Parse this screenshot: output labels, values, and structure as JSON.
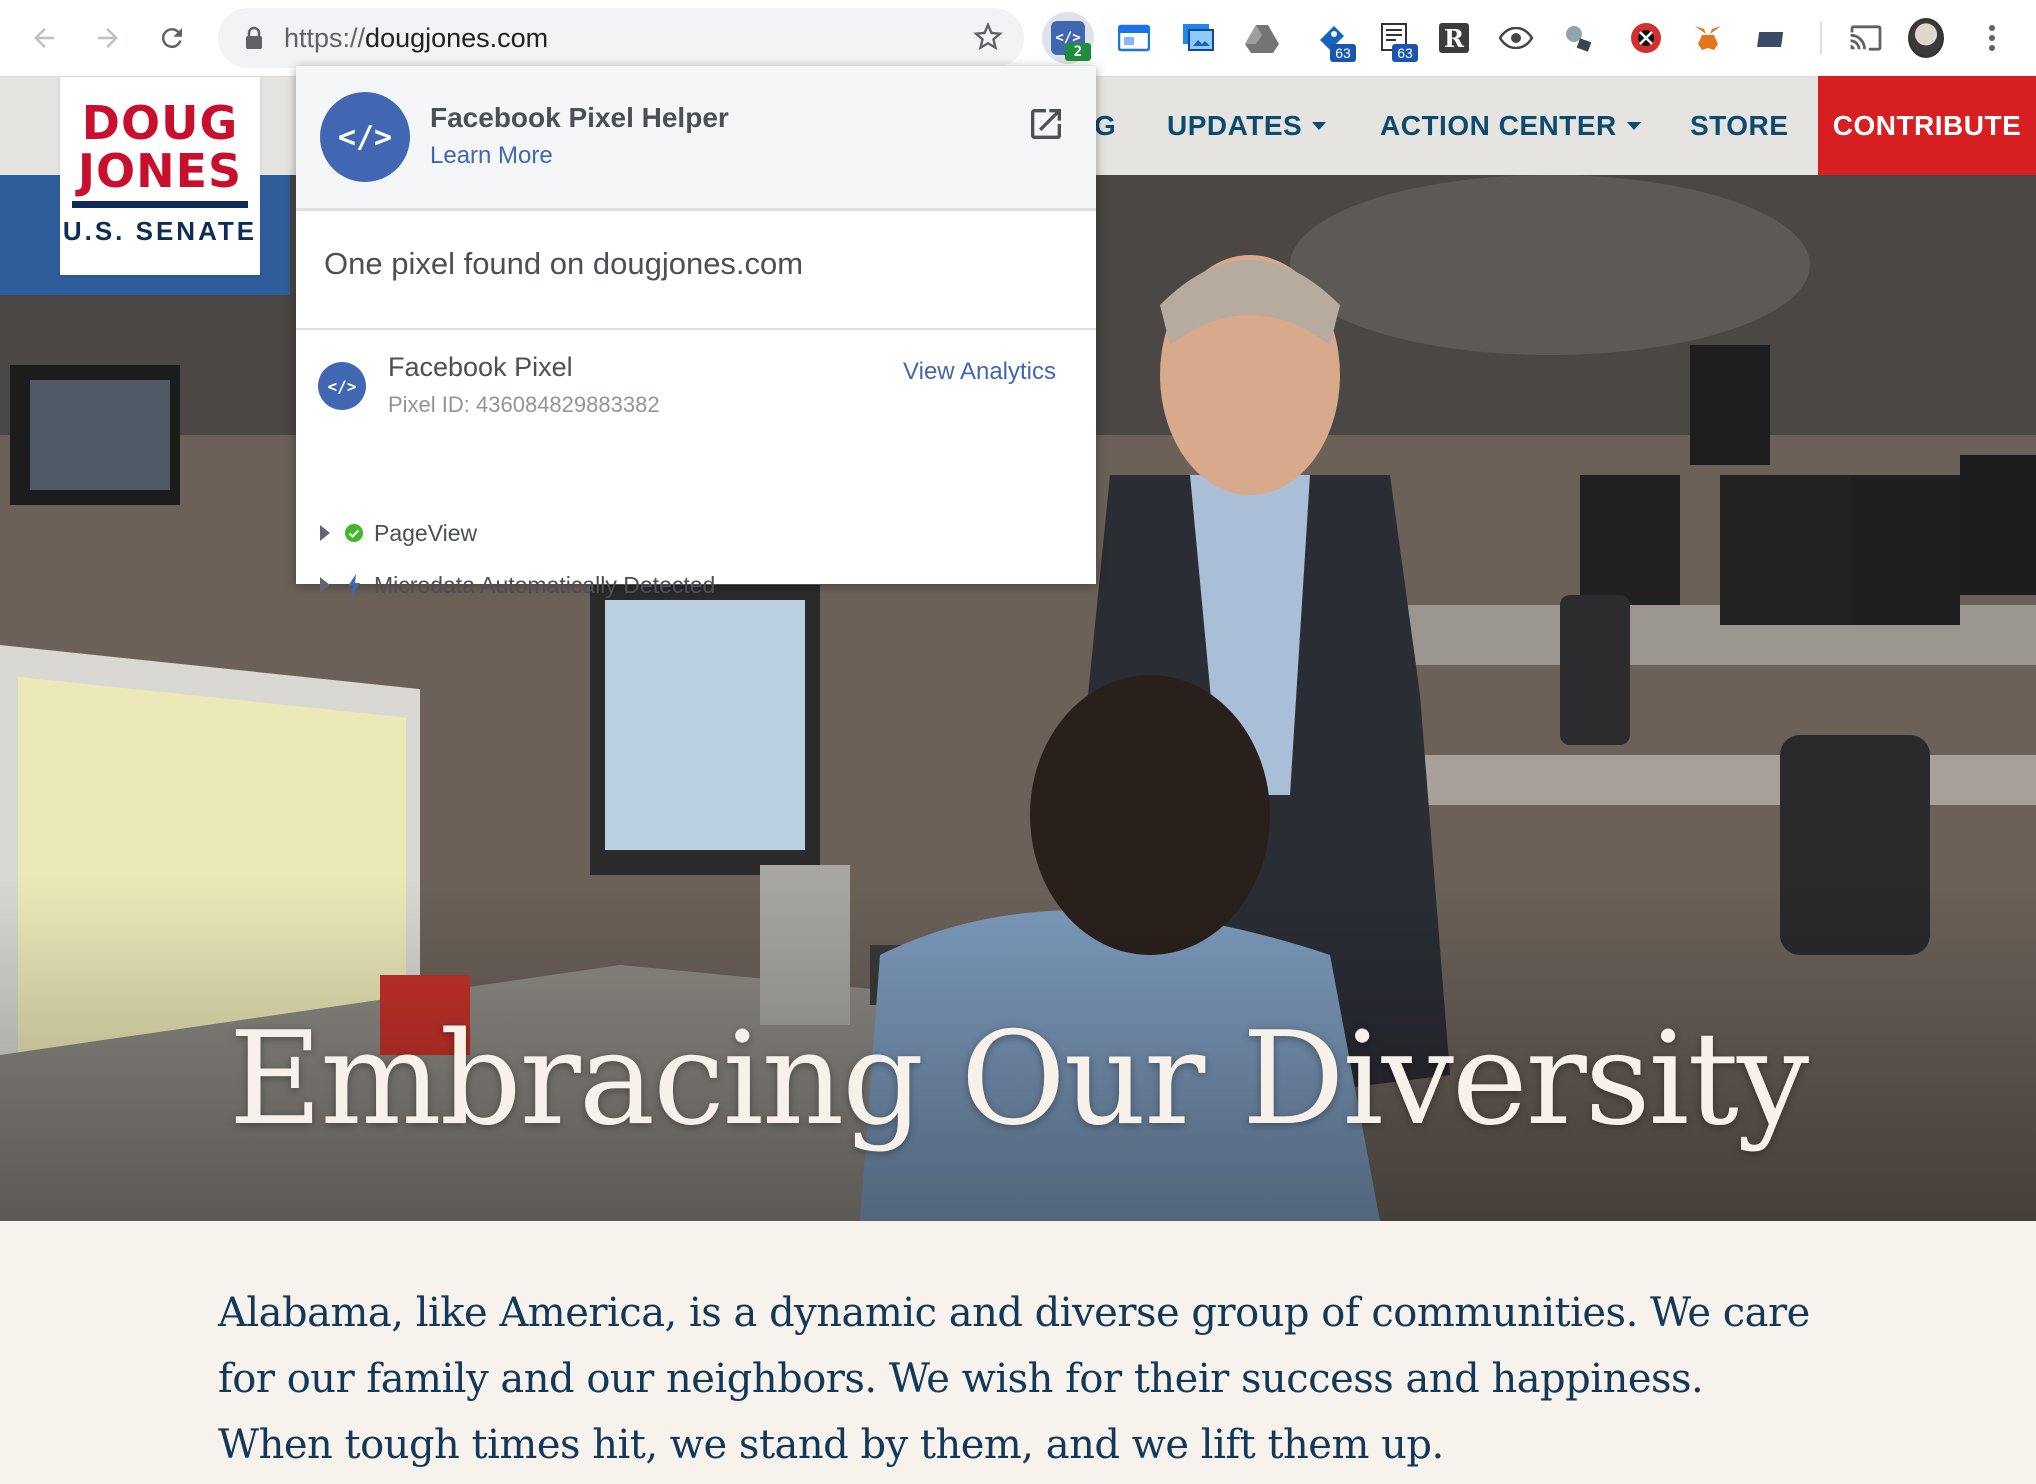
{
  "browser": {
    "url_scheme": "https://",
    "url_host": "dougjones.com",
    "extensions": [
      {
        "icon": "facebook-pixel-helper-icon",
        "badge": "2"
      },
      {
        "icon": "window-extension-icon"
      },
      {
        "icon": "screen-capture-icon"
      },
      {
        "icon": "google-drive-icon"
      },
      {
        "icon": "bookmark-extension-icon",
        "badge": "63"
      },
      {
        "icon": "dictionary-extension-icon",
        "badge": "63"
      },
      {
        "icon": "r-extension-icon"
      },
      {
        "icon": "eye-extension-icon"
      },
      {
        "icon": "satellite-extension-icon"
      },
      {
        "icon": "blocker-extension-icon"
      },
      {
        "icon": "metamask-icon"
      },
      {
        "icon": "folder-extension-icon"
      },
      {
        "icon": "cast-icon"
      },
      {
        "icon": "profile-avatar"
      },
      {
        "icon": "menu-icon"
      }
    ]
  },
  "site": {
    "logo": {
      "line1": "DOUG",
      "line2": "JONES",
      "line3": "U.S. SENATE"
    },
    "nav": {
      "partial": "G",
      "updates": "UPDATES",
      "action_center": "ACTION CENTER",
      "store": "STORE",
      "contribute": "CONTRIBUTE"
    },
    "hero_title": "Embracing Our Diversity",
    "body_text": "Alabama, like America, is a dynamic and diverse group of communities. We care for our family and our neighbors. We wish for their success and happiness. When tough times hit, we stand by them, and we lift them up."
  },
  "popup": {
    "logo_glyph": "</>",
    "title": "Facebook Pixel Helper",
    "learn_more": "Learn More",
    "summary": "One pixel found on dougjones.com",
    "pixel": {
      "name": "Facebook Pixel",
      "id_text": "Pixel ID: 436084829883382",
      "view_analytics": "View Analytics",
      "events": [
        {
          "label": "PageView",
          "status": "success"
        },
        {
          "label": "Microdata Automatically Detected",
          "status": "auto"
        }
      ]
    }
  },
  "colors": {
    "brand_red": "#d71f22",
    "brand_navy": "#0d2d57",
    "facebook_blue": "#4267b2",
    "success_green": "#42b72a"
  }
}
